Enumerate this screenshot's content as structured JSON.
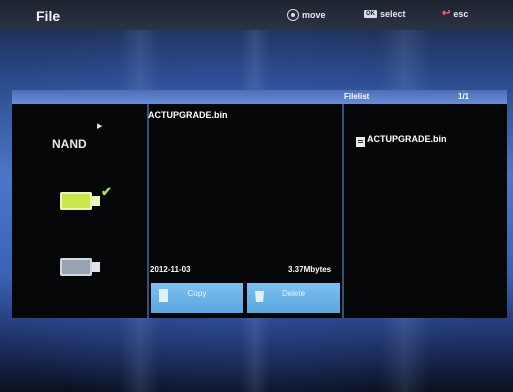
{
  "header": {
    "title": "File",
    "hints": [
      {
        "icon": "dpad-icon",
        "label": "move"
      },
      {
        "icon": "ok-key-icon",
        "icon_text": "OK",
        "label": "select"
      },
      {
        "icon": "return-key-icon",
        "label": "esc"
      }
    ]
  },
  "devices": {
    "nand_label": "NAND",
    "items": [
      {
        "icon": "usb-drive-icon",
        "selected": true,
        "color": "#c9e64a"
      },
      {
        "icon": "usb-drive-icon",
        "selected": false,
        "color": "#9aa3b2"
      }
    ]
  },
  "details": {
    "file_name": "ACTUPGRADE.bin",
    "date": "2012-11-03",
    "size": "3.37Mbytes",
    "copy_label": "Copy",
    "delete_label": "Delete"
  },
  "filelist": {
    "title": "Filelist",
    "page": "1/1",
    "files": [
      {
        "name": "ACTUPGRADE.bin",
        "icon": "file-icon"
      }
    ]
  },
  "colors": {
    "header_bar": "#6a8ed4",
    "button": "#6cb4ea",
    "selected_check": "#a7e83d"
  }
}
